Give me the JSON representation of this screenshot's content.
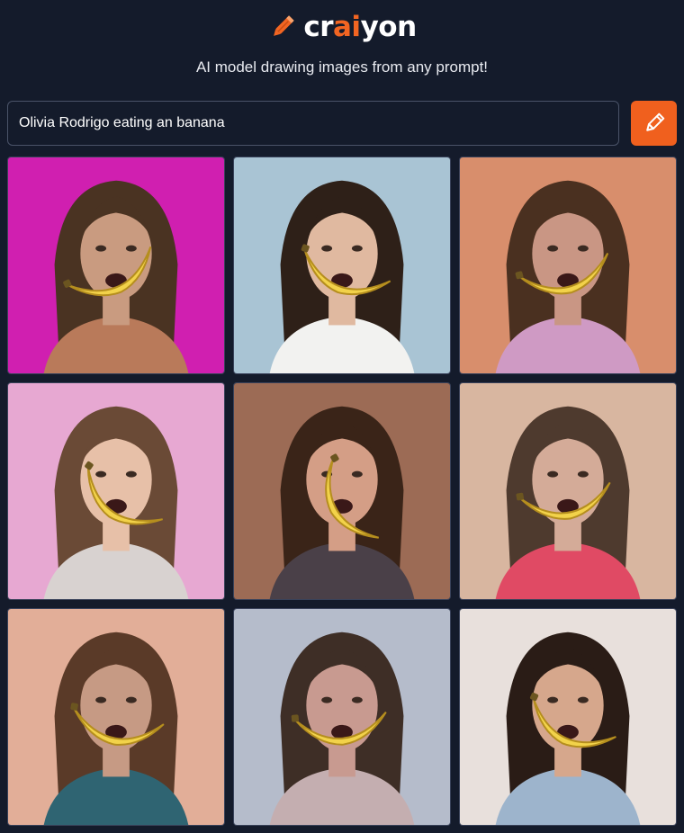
{
  "brand": {
    "name_start": "cr",
    "name_accent": "ai",
    "name_end": "yon",
    "logo_icon": "pencil-icon",
    "accent_color": "#f26522"
  },
  "tagline": "AI model drawing images from any prompt!",
  "prompt": {
    "value": "Olivia Rodrigo eating an banana",
    "placeholder": ""
  },
  "draw_button": {
    "icon": "pencil-icon",
    "color": "#f0601e"
  },
  "results": {
    "images": [
      {
        "background": "#d01fb0",
        "hair": "#4a3322",
        "skin": "#c99b80",
        "clothing": "#b97a5a",
        "banana_angle": -25
      },
      {
        "background": "#a9c4d4",
        "hair": "#2e2018",
        "skin": "#e0b9a0",
        "clothing": "#f2f2f0",
        "banana_angle": 20
      },
      {
        "background": "#d88e6c",
        "hair": "#4a3020",
        "skin": "#c99684",
        "clothing": "#cf9ac4",
        "banana_angle": -15
      },
      {
        "background": "#e7a8d2",
        "hair": "#6a4a36",
        "skin": "#e7c0a8",
        "clothing": "#d8d2d0",
        "banana_angle": 35
      },
      {
        "background": "#9c6b55",
        "hair": "#3a2418",
        "skin": "#d49e86",
        "clothing": "#4a4048",
        "banana_angle": 60
      },
      {
        "background": "#d8b6a0",
        "hair": "#4e3a2e",
        "skin": "#d4ab98",
        "clothing": "#e04a64",
        "banana_angle": -10
      },
      {
        "background": "#e2ae98",
        "hair": "#5a3a28",
        "skin": "#c69a84",
        "clothing": "#2f6472",
        "banana_angle": 10
      },
      {
        "background": "#b5bccb",
        "hair": "#3e2e26",
        "skin": "#c89a90",
        "clothing": "#c4aeb0",
        "banana_angle": -5
      },
      {
        "background": "#e8e0dc",
        "hair": "#2a1c16",
        "skin": "#d6a78c",
        "clothing": "#9db4cc",
        "banana_angle": 25
      }
    ]
  }
}
